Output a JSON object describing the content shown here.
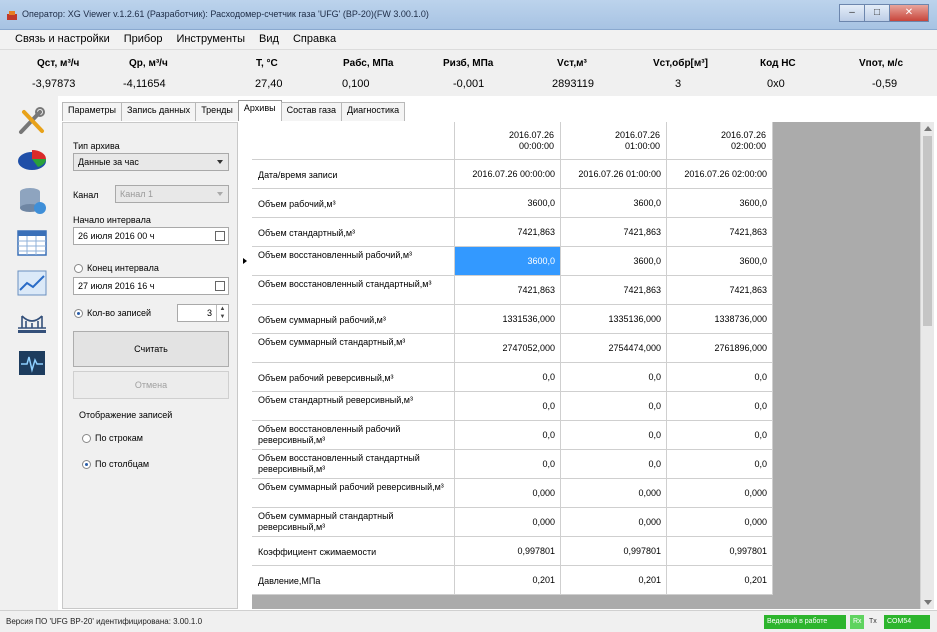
{
  "window": {
    "title": "Оператор: XG Viewer v.1.2.61 (Разработчик): Расходомер-счетчик газа 'UFG' (BP-20)(FW 3.00.1.0)"
  },
  "menu": [
    "Связь и настройки",
    "Прибор",
    "Инструменты",
    "Вид",
    "Справка"
  ],
  "measurements": [
    {
      "header": "Qст, м³/ч",
      "value": "-3,97873"
    },
    {
      "header": "Qр, м³/ч",
      "value": "-4,11654"
    },
    {
      "header": "T, °C",
      "value": "27,40"
    },
    {
      "header": "Pабс, МПа",
      "value": "0,100"
    },
    {
      "header": "Pизб, МПа",
      "value": "-0,001"
    },
    {
      "header": "Vст,м³",
      "value": "2893119"
    },
    {
      "header": "Vст,обр[м³]",
      "value": "3"
    },
    {
      "header": "Код НС",
      "value": "0x0"
    },
    {
      "header": "Vпот, м/с",
      "value": "-0,59"
    }
  ],
  "tabs": [
    "Параметры",
    "Запись данных",
    "Тренды",
    "Архивы",
    "Состав газа",
    "Диагностика"
  ],
  "active_tab": "Архивы",
  "panel": {
    "archive_type_label": "Тип архива",
    "archive_type_value": "Данные за час",
    "channel_label": "Канал",
    "channel_value": "Канал 1",
    "start_label": "Начало интервала",
    "start_value": "26 июля 2016 00 ч",
    "end_label": "Конец интервала",
    "end_value": "27 июля 2016 16 ч",
    "records_label": "Кол-во записей",
    "records_value": "3",
    "read_button": "Считать",
    "cancel_button": "Отмена",
    "display_label": "Отображение записей",
    "by_rows": "По строкам",
    "by_columns": "По столбцам"
  },
  "grid": {
    "col_headers": [
      [
        "2016.07.26",
        "00:00:00"
      ],
      [
        "2016.07.26",
        "01:00:00"
      ],
      [
        "2016.07.26",
        "02:00:00"
      ]
    ],
    "rows": [
      {
        "name": "Дата/время записи",
        "values": [
          "2016.07.26 00:00:00",
          "2016.07.26 01:00:00",
          "2016.07.26 02:00:00"
        ]
      },
      {
        "name": "Объем рабочий,м³",
        "values": [
          "3600,0",
          "3600,0",
          "3600,0"
        ]
      },
      {
        "name": "Объем стандартный,м³",
        "values": [
          "7421,863",
          "7421,863",
          "7421,863"
        ]
      },
      {
        "name": "Объем восстановленный рабочий,м³",
        "values": [
          "3600,0",
          "3600,0",
          "3600,0"
        ]
      },
      {
        "name": "Объем восстановленный стандартный,м³",
        "values": [
          "7421,863",
          "7421,863",
          "7421,863"
        ]
      },
      {
        "name": "Объем суммарный рабочий,м³",
        "values": [
          "1331536,000",
          "1335136,000",
          "1338736,000"
        ]
      },
      {
        "name": "Объем суммарный стандартный,м³",
        "values": [
          "2747052,000",
          "2754474,000",
          "2761896,000"
        ]
      },
      {
        "name": "Объем рабочий реверсивный,м³",
        "values": [
          "0,0",
          "0,0",
          "0,0"
        ]
      },
      {
        "name": "Объем стандартный реверсивный,м³",
        "values": [
          "0,0",
          "0,0",
          "0,0"
        ]
      },
      {
        "name": "Объем восстановленный рабочий реверсивный,м³",
        "values": [
          "0,0",
          "0,0",
          "0,0"
        ]
      },
      {
        "name": "Объем восстановленный стандартный реверсивный,м³",
        "values": [
          "0,0",
          "0,0",
          "0,0"
        ]
      },
      {
        "name": "Объем суммарный рабочий реверсивный,м³",
        "values": [
          "0,000",
          "0,000",
          "0,000"
        ]
      },
      {
        "name": "Объем суммарный стандартный реверсивный,м³",
        "values": [
          "0,000",
          "0,000",
          "0,000"
        ]
      },
      {
        "name": "Коэффициент сжимаемости",
        "values": [
          "0,997801",
          "0,997801",
          "0,997801"
        ]
      },
      {
        "name": "Давление,МПа",
        "values": [
          "0,201",
          "0,201",
          "0,201"
        ]
      }
    ]
  },
  "status": {
    "version": "Версия ПО 'UFG BP-20' идентифицирована: 3.00.1.0",
    "working": "Ведомый в работе",
    "rx": "Rx",
    "tx": "Tx",
    "port": "COM54"
  },
  "colors": {
    "selection": "#3399ff",
    "status_green": "#2db52d"
  }
}
